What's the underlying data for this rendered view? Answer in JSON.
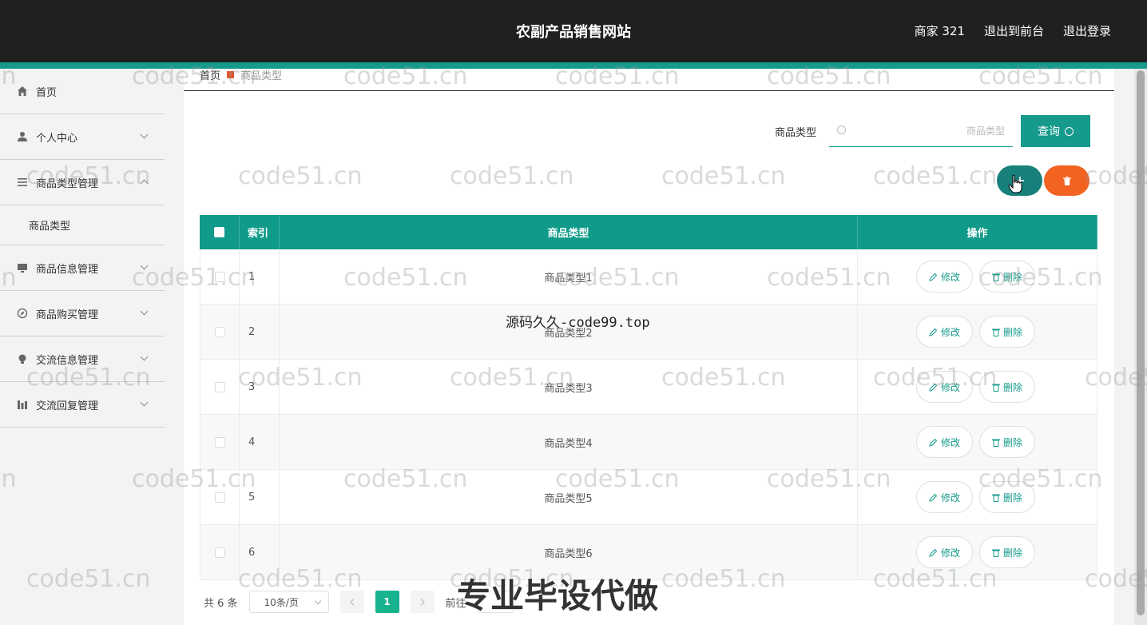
{
  "header": {
    "title": "农副产品销售网站",
    "user": "商家 321",
    "front_link": "退出到前台",
    "logout": "退出登录"
  },
  "sidebar": {
    "items": [
      {
        "label": "首页",
        "icon": "home-icon"
      },
      {
        "label": "个人中心",
        "icon": "user-icon"
      },
      {
        "label": "商品类型管理",
        "icon": "menu-icon",
        "expanded": true
      },
      {
        "label": "商品信息管理",
        "icon": "monitor-icon"
      },
      {
        "label": "商品购买管理",
        "icon": "compass-icon"
      },
      {
        "label": "交流信息管理",
        "icon": "bulb-icon"
      },
      {
        "label": "交流回复管理",
        "icon": "chart-icon"
      }
    ],
    "sub_item": "商品类型"
  },
  "breadcrumb": {
    "home": "首页",
    "current": "商品类型"
  },
  "search": {
    "label": "商品类型",
    "placeholder": "商品类型",
    "button": "查询"
  },
  "table": {
    "headers": {
      "index": "索引",
      "type": "商品类型",
      "ops": "操作"
    },
    "rows": [
      {
        "index": "1",
        "name": "商品类型1"
      },
      {
        "index": "2",
        "name": "商品类型2"
      },
      {
        "index": "3",
        "name": "商品类型3"
      },
      {
        "index": "4",
        "name": "商品类型4"
      },
      {
        "index": "5",
        "name": "商品类型5"
      },
      {
        "index": "6",
        "name": "商品类型6"
      }
    ],
    "edit_label": "修改",
    "delete_label": "删除"
  },
  "pagination": {
    "total": "共 6 条",
    "page_size": "10条/页",
    "current_page": "1",
    "goto_prefix": "前往"
  },
  "overlays": {
    "watermark": "code51.cn",
    "caption1": "源码久久-code99.top",
    "caption2": "专业毕设代做"
  },
  "colors": {
    "accent": "#159a8c",
    "danger": "#f26322",
    "header_bg": "#1f201f"
  }
}
